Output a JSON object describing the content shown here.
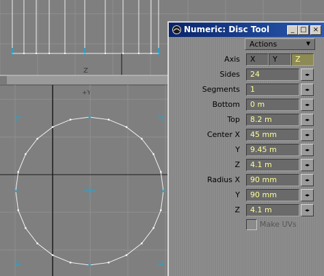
{
  "viewport": {
    "top_axis_label": "Z",
    "bottom_axis_label": "+Y",
    "colors": {
      "background": "#7f7f7f",
      "grid": "#8e8e8e",
      "axis": "#1a1a1a",
      "mesh": "#f5f5f5",
      "guide": "#1ba6d6"
    }
  },
  "panel": {
    "title": "Numeric: Disc Tool",
    "controls": {
      "minimize": "_",
      "maximize": "□",
      "close": "×"
    },
    "actions_label": "Actions",
    "axis": {
      "label": "Axis",
      "options": [
        "X",
        "Y",
        "Z"
      ],
      "selected": "Z"
    },
    "fields": [
      {
        "label": "Sides",
        "value": "24"
      },
      {
        "label": "Segments",
        "value": "1"
      },
      {
        "label": "Bottom",
        "value": "0 m"
      },
      {
        "label": "Top",
        "value": "8.2 m"
      },
      {
        "label": "Center X",
        "value": "45 mm"
      },
      {
        "label": "Y",
        "value": "9.45 m"
      },
      {
        "label": "Z",
        "value": "4.1 m"
      },
      {
        "label": "Radius X",
        "value": "90 mm"
      },
      {
        "label": "Y",
        "value": "90 mm"
      },
      {
        "label": "Z",
        "value": "4.1 m"
      }
    ],
    "make_uvs_label": "Make UVs",
    "stepper_glyph": "◂▸"
  }
}
